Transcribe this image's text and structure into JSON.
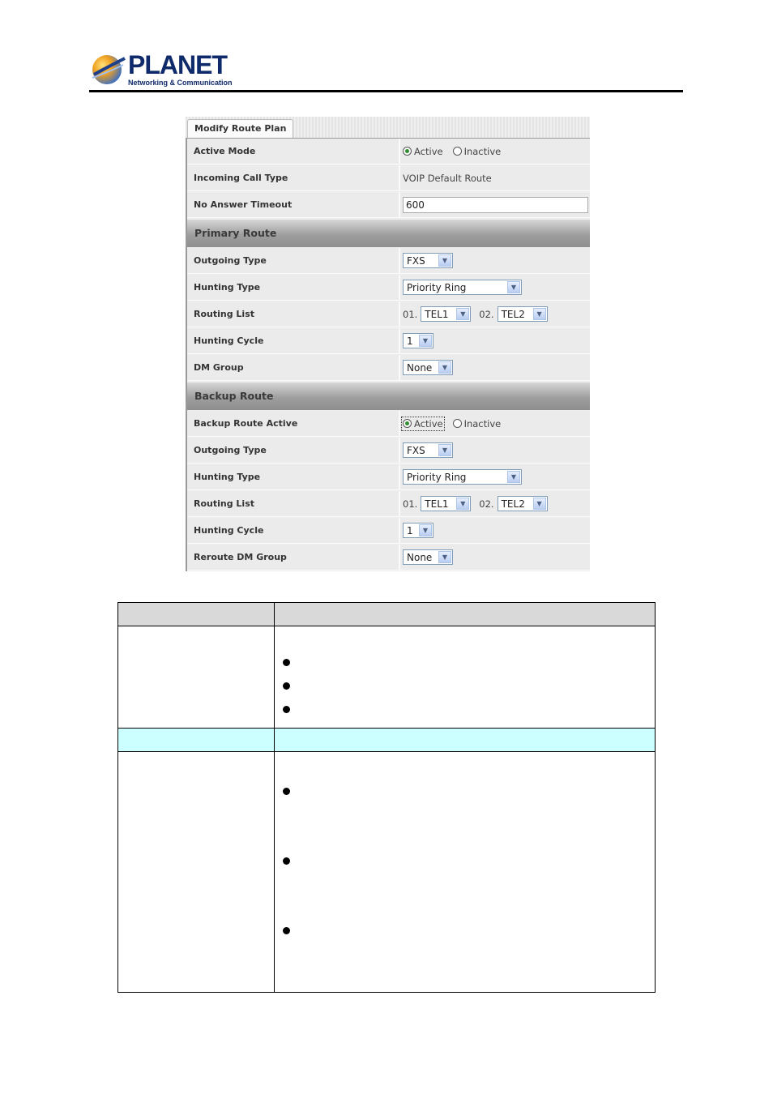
{
  "brand": {
    "name": "PLANET",
    "tagline": "Networking & Communication"
  },
  "panel": {
    "tab": "Modify Route Plan",
    "rows": {
      "active_mode": {
        "label": "Active Mode",
        "options": [
          "Active",
          "Inactive"
        ],
        "selected": "Active"
      },
      "incoming_call_type": {
        "label": "Incoming Call Type",
        "value": "VOIP Default Route"
      },
      "no_answer_timeout": {
        "label": "No Answer Timeout",
        "value": "600"
      }
    },
    "primary": {
      "title": "Primary Route",
      "outgoing_type": {
        "label": "Outgoing Type",
        "value": "FXS"
      },
      "hunting_type": {
        "label": "Hunting Type",
        "value": "Priority Ring"
      },
      "routing_list": {
        "label": "Routing List",
        "n1": "01.",
        "v1": "TEL1",
        "n2": "02.",
        "v2": "TEL2"
      },
      "hunting_cycle": {
        "label": "Hunting Cycle",
        "value": "1"
      },
      "dm_group": {
        "label": "DM Group",
        "value": "None"
      }
    },
    "backup": {
      "title": "Backup Route",
      "active": {
        "label": "Backup Route Active",
        "options": [
          "Active",
          "Inactive"
        ],
        "selected": "Active"
      },
      "outgoing_type": {
        "label": "Outgoing Type",
        "value": "FXS"
      },
      "hunting_type": {
        "label": "Hunting Type",
        "value": "Priority Ring"
      },
      "routing_list": {
        "label": "Routing List",
        "n1": "01.",
        "v1": "TEL1",
        "n2": "02.",
        "v2": "TEL2"
      },
      "hunting_cycle": {
        "label": "Hunting Cycle",
        "value": "1"
      },
      "dm_group": {
        "label": "Reroute DM Group",
        "value": "None"
      }
    }
  },
  "colors": {
    "logo_blue": "#0f2a6b",
    "highlight_row": "#ccffff",
    "table_header": "#d9d9d9",
    "radio_on": "#2e8b2e"
  }
}
